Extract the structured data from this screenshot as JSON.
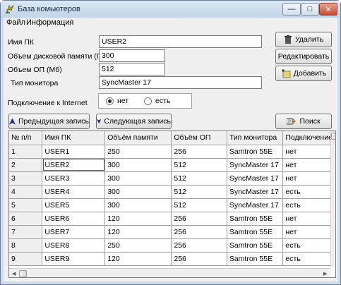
{
  "window": {
    "title": "База комьютеров",
    "minimize": "—",
    "maximize": "□",
    "close": "✕"
  },
  "menu": [
    {
      "label": "Файл"
    },
    {
      "label": "Информация"
    }
  ],
  "form": {
    "pc_name": {
      "label": "Имя ПК",
      "value": "USER2"
    },
    "disk": {
      "label": "Объем дисковой памяти (Гб)",
      "value": "300"
    },
    "ram": {
      "label": "Объем ОП (Мб)",
      "value": "512"
    },
    "monitor": {
      "label": "Тип  монитора",
      "value": "SyncMaster 17"
    },
    "internet": {
      "label": "Подключение к Internet",
      "options": [
        "нет",
        "есть"
      ],
      "selected": "нет"
    }
  },
  "buttons": {
    "delete": "Удалить",
    "edit": "Редактировать",
    "add": "Добавить",
    "prev": "Предыдущая запись",
    "next": "Следующая запись",
    "search": "Поиск"
  },
  "table": {
    "columns": [
      "№ п/п",
      "Имя ПК",
      "Объём памяти",
      "Объём ОП",
      "Тип монитора",
      "Подключение"
    ],
    "rows": [
      [
        "1",
        "USER1",
        "250",
        "256",
        "Samtron 55E",
        "нет"
      ],
      [
        "2",
        "USER2",
        "300",
        "512",
        "SyncMaster 17",
        "нет"
      ],
      [
        "3",
        "USER3",
        "300",
        "512",
        "SyncMaster 17",
        "нет"
      ],
      [
        "4",
        "USER4",
        "300",
        "512",
        "SyncMaster 17",
        "есть"
      ],
      [
        "5",
        "USER5",
        "300",
        "512",
        "SyncMaster 17",
        "есть"
      ],
      [
        "6",
        "USER6",
        "120",
        "256",
        "Samtron 55E",
        "нет"
      ],
      [
        "7",
        "USER7",
        "120",
        "256",
        "Samtron 55E",
        "нет"
      ],
      [
        "8",
        "USER8",
        "250",
        "256",
        "Samtron 55E",
        "есть"
      ],
      [
        "9",
        "USER9",
        "120",
        "256",
        "Samtron 55E",
        "есть"
      ]
    ]
  },
  "colors": {
    "window_frame": "#cfdcec",
    "face": "#f0f0f0",
    "close_button": "#c54a2e"
  }
}
